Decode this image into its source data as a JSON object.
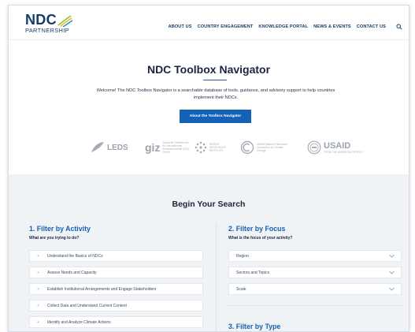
{
  "header": {
    "logo_main": "NDC",
    "logo_sub": "PARTNERSHIP",
    "nav": [
      "ABOUT US",
      "COUNTRY ENGAGEMENT",
      "KNOWLEDGE PORTAL",
      "NEWS & EVENTS",
      "CONTACT US"
    ]
  },
  "hero": {
    "title": "NDC Toolbox Navigator",
    "description": "Welcome! The NDC Toolbox Navigator is a searchable database of tools, guidance, and advisory support to help countries implement their NDCs.",
    "button_label": "About the Toolbox Navigator"
  },
  "partners": {
    "leds_name": "LEDS",
    "giz_name": "giz",
    "giz_small": "Deutsche Gesellschaft für Internationale Zusammenarbeit (GIZ) GmbH",
    "wri_small": "WORLD RESOURCES INSTITUTE",
    "unfccc_small": "United Nations Framework Convention on Climate Change",
    "usaid_name": "USAID",
    "usaid_small": "FROM THE AMERICAN PEOPLE"
  },
  "search": {
    "title": "Begin Your Search",
    "activity": {
      "title": "1. Filter by Activity",
      "subtitle": "What are you trying to do?",
      "items": [
        "Understand the Basics of NDCs",
        "Assess Needs and Capacity",
        "Establish Institutional Arrangements and Engage Stakeholders",
        "Collect Data and Understand Current Context",
        "Identify and Analyze Climate Actions"
      ]
    },
    "focus": {
      "title": "2. Filter by Focus",
      "subtitle": "What is the focus of your activity?",
      "selects": [
        "Region",
        "Sectors and Topics",
        "Scale"
      ]
    },
    "type": {
      "title": "3. Filter by Type"
    }
  },
  "colors": {
    "primary_blue": "#1462b8",
    "heading_blue": "#1560b4",
    "navy": "#143d6a",
    "section_bg": "#eff3f6"
  }
}
